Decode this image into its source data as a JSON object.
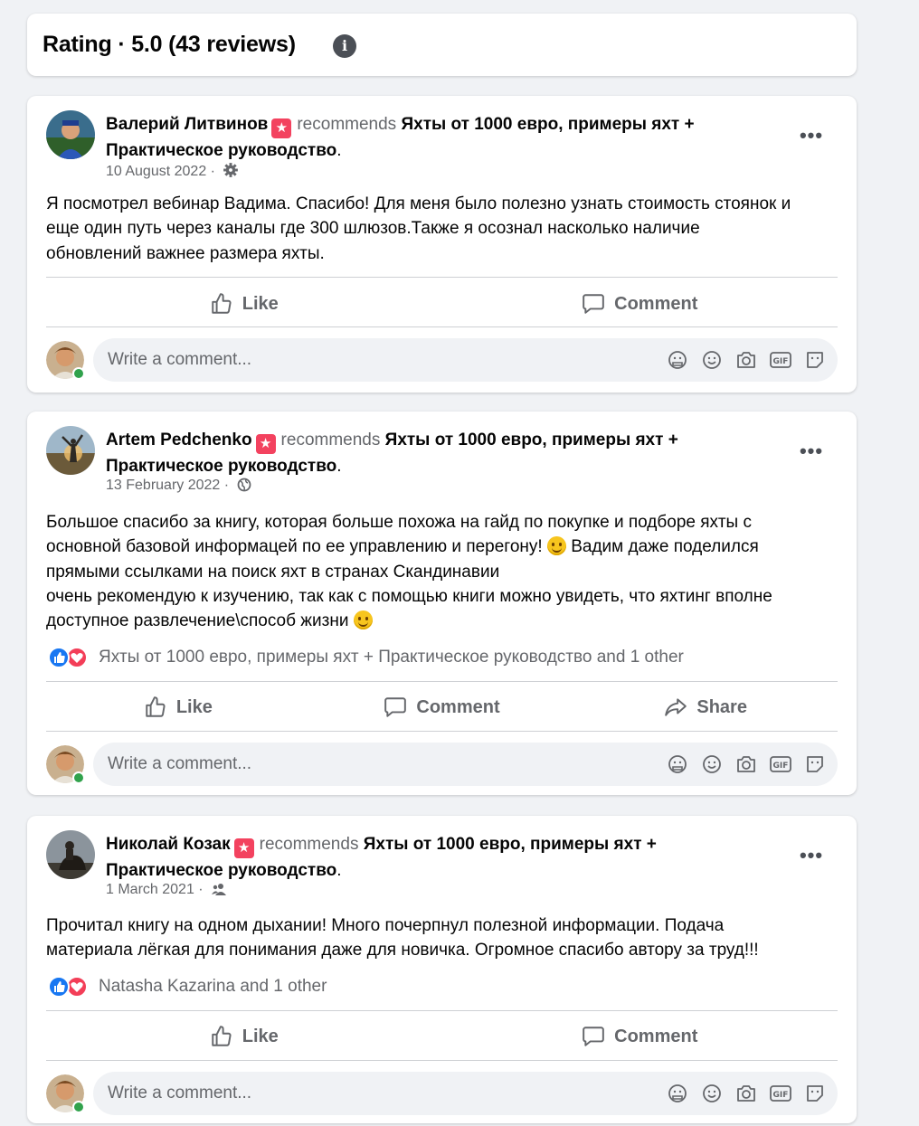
{
  "rating": {
    "title": "Rating · 5.0 (43 reviews)",
    "info_icon": "info-icon"
  },
  "colors": {
    "background": "#f0f2f5",
    "recommend_badge": "#f3425f",
    "like_reaction": "#1877f2",
    "love_reaction": "#f33e58",
    "online": "#31a24c",
    "secondary_text": "#65676b"
  },
  "posts": [
    {
      "author": "Валерий Литвинов",
      "recommends": "recommends",
      "page": "Яхты от 1000 евро, примеры яхт + Практическое руководство",
      "period": ".",
      "date": "10 August 2022 ·",
      "audience_icon": "gear-icon",
      "text": [
        "Я посмотрел вебинар Вадима. Спасибо! Для меня было полезно узнать стоимость стоянок и",
        "еще один путь через каналы где 300 шлюзов.Также я осознал насколько наличие",
        "обновлений важнее размера яхты."
      ],
      "reactions": null,
      "actions": [
        "Like",
        "Comment"
      ],
      "comment_placeholder": "Write a comment..."
    },
    {
      "author": "Artem Pedchenko",
      "recommends": "recommends",
      "page": "Яхты от 1000 евро, примеры яхт + Практическое руководство",
      "period": ".",
      "date": "13 February 2022 ·",
      "audience_icon": "globe-icon",
      "text": [
        "Большое спасибо за книгу, которая больше похожа на гайд по покупке и подборе яхты с",
        "основной базовой информацей по ее управлению и перегону! ",
        " Вадим даже поделился",
        "прямыми ссылками на поиск яхт в странах Скандинавии",
        "очень рекомендую к изучению, так как с помощью книги можно увидеть, что яхтинг вполне",
        "доступное развлечение\\способ жизни "
      ],
      "reactions": "Яхты от 1000 евро, примеры яхт + Практическое руководство and 1 other",
      "actions": [
        "Like",
        "Comment",
        "Share"
      ],
      "comment_placeholder": "Write a comment..."
    },
    {
      "author": "Николай Козак",
      "recommends": "recommends",
      "page": "Яхты от 1000 евро, примеры яхт + Практическое руководство",
      "period": ".",
      "date": "1 March 2021 ·",
      "audience_icon": "friends-icon",
      "text": [
        "Прочитал книгу на одном дыхании! Много почерпнул полезной информации. Подача",
        "материала лёгкая для понимания даже для новичка. Огромное спасибо автору за труд!!!"
      ],
      "reactions": "Natasha Kazarina and 1 other",
      "actions": [
        "Like",
        "Comment"
      ],
      "comment_placeholder": "Write a comment..."
    }
  ],
  "comment_box_icons": [
    "avatar-sticker-icon",
    "emoji-icon",
    "camera-icon",
    "gif-icon",
    "sticker-icon"
  ]
}
